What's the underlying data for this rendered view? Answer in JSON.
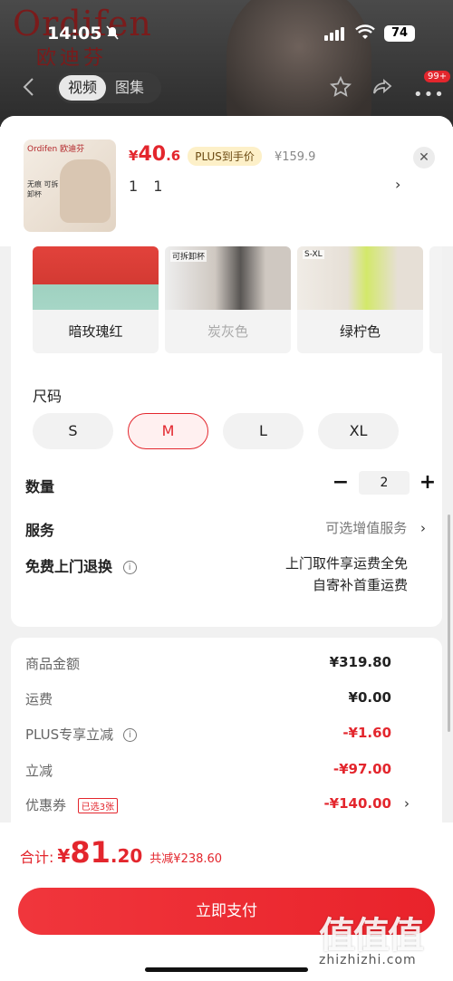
{
  "status_bar": {
    "time": "14:05",
    "battery": "74"
  },
  "background_page": {
    "brand": "Ordifen",
    "brand_cn": "欧迪芬",
    "media_tabs": [
      "视频",
      "图集"
    ],
    "message_badge": "99+"
  },
  "product": {
    "thumb_brand": "Ordifen 欧迪芬",
    "thumb_text": "无痕 可拆卸杯",
    "currency": "¥",
    "price_int": "40",
    "price_dec": ".6",
    "plus_tag": "PLUS到手价",
    "original_price": "¥159.9",
    "selection": "1 1"
  },
  "colors": [
    {
      "label": "暗玫瑰红",
      "disabled": false
    },
    {
      "label": "炭灰色",
      "disabled": true,
      "tag": "可拆卸杯"
    },
    {
      "label": "绿柠色",
      "disabled": false,
      "tag": "S-XL"
    }
  ],
  "size_section": {
    "label": "尺码",
    "options": [
      "S",
      "M",
      "L",
      "XL"
    ],
    "selected": "M"
  },
  "quantity": {
    "label": "数量",
    "value": "2",
    "minus": "−",
    "plus": "+"
  },
  "service": {
    "label": "服务",
    "value": "可选增值服务",
    "chevron": "›"
  },
  "return_service": {
    "label": "免费上门退换",
    "line1": "上门取件享运费全免",
    "line2": "自寄补首重运费"
  },
  "price_details": [
    {
      "label": "商品金额",
      "value": "¥319.80",
      "red": false
    },
    {
      "label": "运费",
      "value": "¥0.00",
      "red": false
    },
    {
      "label": "PLUS专享立减",
      "value": "-¥1.60",
      "red": true,
      "info": true
    },
    {
      "label": "立减",
      "value": "-¥97.00",
      "red": true
    },
    {
      "label": "优惠券",
      "value": "-¥140.00",
      "red": true,
      "tag": "已选3张",
      "chevron": "›"
    }
  ],
  "footer": {
    "total_label": "合计:",
    "total_currency": "¥",
    "total_int": "81",
    "total_dec": ".20",
    "total_save": "共减¥238.60",
    "pay_button": "立即支付",
    "watermark_site": "zhizhizhi.com"
  },
  "accent_color": "#e3262d"
}
